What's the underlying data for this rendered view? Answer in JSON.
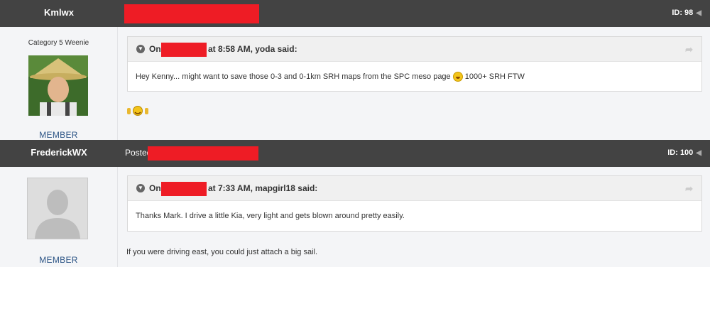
{
  "post1": {
    "author": "Kmlwx",
    "id_label": "ID: 98",
    "user_title": "Category 5 Weenie",
    "role": "MEMBER",
    "quote": {
      "on": "On",
      "suffix": "at 8:58 AM, yoda said:",
      "text": "Hey Kenny... might want to save those 0-3 and 0-1km SRH maps from the SPC meso page",
      "text_after": "1000+ SRH FTW"
    },
    "reply_emoji": "weenie-emoji"
  },
  "post2": {
    "author": "FrederickWX",
    "posted_label": "Posted",
    "id_label": "ID: 100",
    "role": "MEMBER",
    "quote": {
      "on": "On",
      "suffix": "at 7:33 AM, mapgirl18 said:",
      "text": "Thanks Mark. I drive a little Kia, very light and gets blown around pretty easily."
    },
    "reply_text": "If you were driving east, you could just attach a big sail."
  },
  "colors": {
    "header_bg": "#434343",
    "redaction": "#ee1c25",
    "role_text": "#2d5586",
    "body_bg": "#f4f5f7"
  }
}
